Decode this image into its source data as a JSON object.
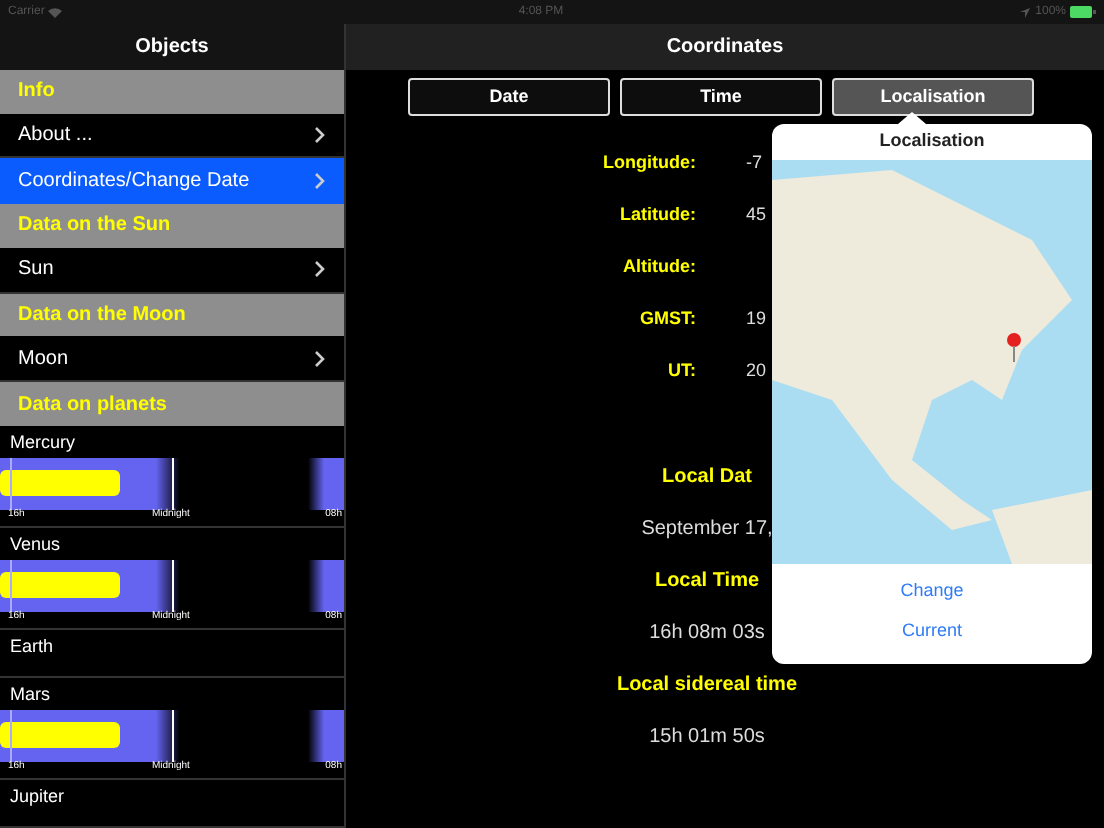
{
  "status_bar": {
    "carrier": "Carrier",
    "time": "4:08 PM",
    "battery": "100%"
  },
  "sidebar": {
    "title": "Objects",
    "items": [
      {
        "kind": "header",
        "label": "Info"
      },
      {
        "kind": "row",
        "label": "About ...",
        "selected": false
      },
      {
        "kind": "row",
        "label": "Coordinates/Change Date",
        "selected": true
      },
      {
        "kind": "header",
        "label": "Data on the Sun"
      },
      {
        "kind": "row",
        "label": "Sun",
        "selected": false
      },
      {
        "kind": "header",
        "label": "Data on the Moon"
      },
      {
        "kind": "row",
        "label": "Moon",
        "selected": false
      },
      {
        "kind": "header",
        "label": "Data on planets"
      },
      {
        "kind": "planet",
        "label": "Mercury",
        "chart": {
          "start": "16h",
          "middle": "Midnight",
          "end": "08h"
        }
      },
      {
        "kind": "planet",
        "label": "Venus",
        "chart": {
          "start": "16h",
          "middle": "Midnight",
          "end": "08h"
        }
      },
      {
        "kind": "planet",
        "label": "Earth"
      },
      {
        "kind": "planet",
        "label": "Mars",
        "chart": {
          "start": "16h",
          "middle": "Midnight",
          "end": "08h"
        }
      },
      {
        "kind": "planet",
        "label": "Jupiter"
      }
    ]
  },
  "main": {
    "title": "Coordinates",
    "tabs": [
      {
        "label": "Date",
        "selected": false
      },
      {
        "label": "Time",
        "selected": false
      },
      {
        "label": "Localisation",
        "selected": true
      }
    ],
    "fields": [
      {
        "label": "Longitude:",
        "value": "-7"
      },
      {
        "label": "Latitude:",
        "value": "45"
      },
      {
        "label": "Altitude:"
      },
      {
        "label": "GMST:",
        "value": "19"
      },
      {
        "label": "UT:",
        "value": "20"
      }
    ],
    "details": [
      {
        "kind": "heading",
        "text": "Local Dat"
      },
      {
        "kind": "value",
        "text": "September 17,"
      },
      {
        "kind": "heading",
        "text": "Local Time"
      },
      {
        "kind": "value",
        "text": "16h 08m 03s"
      },
      {
        "kind": "heading",
        "text": "Local sidereal time"
      },
      {
        "kind": "value",
        "text": "15h 01m 50s"
      }
    ]
  },
  "popover": {
    "title": "Localisation",
    "actions": [
      "Change",
      "Current"
    ]
  }
}
